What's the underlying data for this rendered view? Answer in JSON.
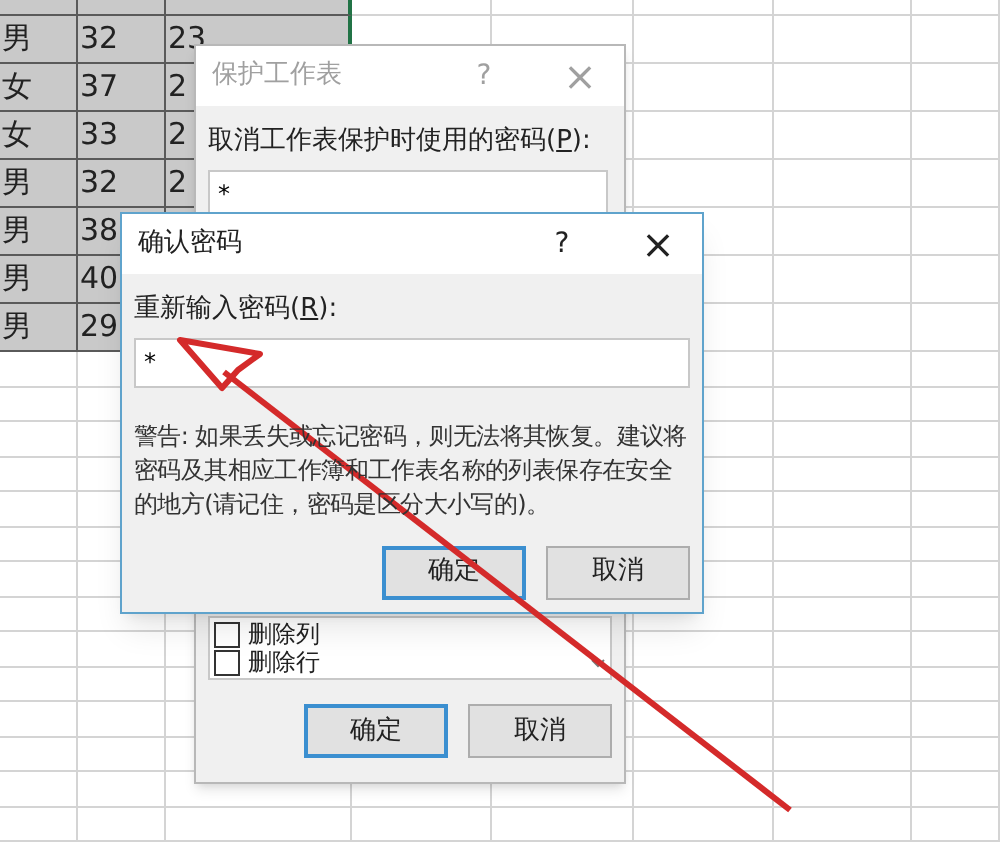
{
  "sheet": {
    "rows": [
      {
        "cells": [
          "男",
          "32",
          "23"
        ]
      },
      {
        "cells": [
          "女",
          "37",
          "2"
        ]
      },
      {
        "cells": [
          "女",
          "33",
          "2"
        ]
      },
      {
        "cells": [
          "男",
          "32",
          "2"
        ]
      },
      {
        "cells": [
          "男",
          "38"
        ]
      },
      {
        "cells": [
          "男",
          "40"
        ]
      },
      {
        "cells": [
          "男",
          "29"
        ]
      }
    ]
  },
  "protect_dialog": {
    "title": "保护工作表",
    "active": false,
    "help": "?",
    "close": "×",
    "label": {
      "before": "取消工作表保护时使用的密码(",
      "key": "P",
      "after": "):"
    },
    "password": "*",
    "options": [
      {
        "label": "删除列",
        "checked": false
      },
      {
        "label": "删除行",
        "checked": false
      }
    ],
    "buttons": [
      {
        "label": "确定",
        "default": true
      },
      {
        "label": "取消",
        "default": false
      }
    ]
  },
  "confirm_dialog": {
    "title": "确认密码",
    "active": true,
    "help": "?",
    "close": "×",
    "label": {
      "before": "重新输入密码(",
      "key": "R",
      "after": "):"
    },
    "password": "*",
    "warning": "警告: 如果丢失或忘记密码，则无法将其恢复。建议将密码及其相应工作簿和工作表名称的列表保存在安全的地方(请记住，密码是区分大小写的)。",
    "buttons": [
      {
        "label": "确定",
        "default": true
      },
      {
        "label": "取消",
        "default": false
      }
    ]
  }
}
